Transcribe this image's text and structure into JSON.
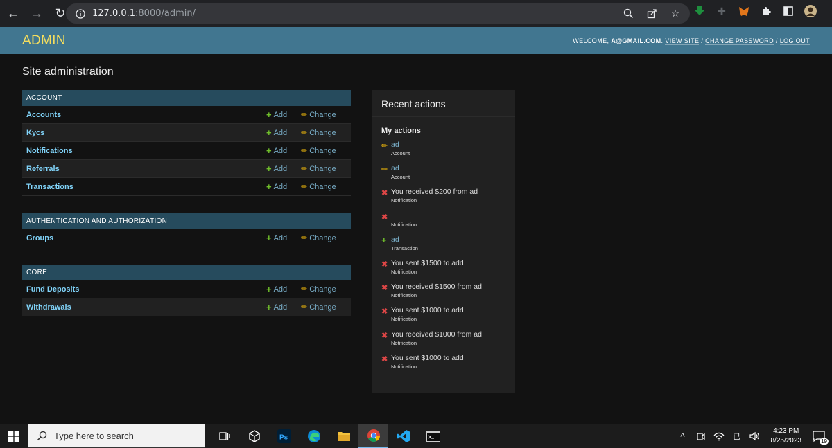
{
  "browser": {
    "url_host": "127.0.0.1",
    "url_path": ":8000/admin/"
  },
  "header": {
    "brand": "ADMIN",
    "welcome_prefix": "WELCOME,",
    "user": "A@GMAIL.COM",
    "view_site": "VIEW SITE",
    "change_password": "CHANGE PASSWORD",
    "log_out": "LOG OUT",
    "sep": "/"
  },
  "page": {
    "title": "Site administration"
  },
  "modules": [
    {
      "caption": "ACCOUNT",
      "rows": [
        {
          "name": "Accounts",
          "add": "Add",
          "change": "Change"
        },
        {
          "name": "Kycs",
          "add": "Add",
          "change": "Change"
        },
        {
          "name": "Notifications",
          "add": "Add",
          "change": "Change"
        },
        {
          "name": "Referrals",
          "add": "Add",
          "change": "Change"
        },
        {
          "name": "Transactions",
          "add": "Add",
          "change": "Change"
        }
      ]
    },
    {
      "caption": "AUTHENTICATION AND AUTHORIZATION",
      "rows": [
        {
          "name": "Groups",
          "add": "Add",
          "change": "Change"
        }
      ]
    },
    {
      "caption": "CORE",
      "rows": [
        {
          "name": "Fund Deposits",
          "add": "Add",
          "change": "Change"
        },
        {
          "name": "Withdrawals",
          "add": "Add",
          "change": "Change"
        }
      ]
    }
  ],
  "recent": {
    "title": "Recent actions",
    "my_actions": "My actions",
    "items": [
      {
        "kind": "change",
        "text": "ad",
        "type": "Account"
      },
      {
        "kind": "change",
        "text": "ad",
        "type": "Account"
      },
      {
        "kind": "delete",
        "text": "You received $200 from ad",
        "type": "Notification"
      },
      {
        "kind": "delete",
        "text": "",
        "type": "Notification"
      },
      {
        "kind": "add",
        "text": "ad",
        "type": "Transaction"
      },
      {
        "kind": "delete",
        "text": "You sent $1500 to add",
        "type": "Notification"
      },
      {
        "kind": "delete",
        "text": "You received $1500 from ad",
        "type": "Notification"
      },
      {
        "kind": "delete",
        "text": "You sent $1000 to add",
        "type": "Notification"
      },
      {
        "kind": "delete",
        "text": "You received $1000 from ad",
        "type": "Notification"
      },
      {
        "kind": "delete",
        "text": "You sent $1000 to add",
        "type": "Notification"
      }
    ]
  },
  "taskbar": {
    "search_placeholder": "Type here to search",
    "time": "4:23 PM",
    "date": "8/25/2023",
    "notification_count": "19"
  },
  "colors": {
    "header_bg": "#417690",
    "brand": "#f5dd5d",
    "caption_bg": "#264b5d",
    "link": "#79aec8",
    "model_link": "#81d4fa",
    "add_icon": "#70bf2b",
    "change_icon": "#efb80b",
    "delete_icon": "#dd4646"
  }
}
